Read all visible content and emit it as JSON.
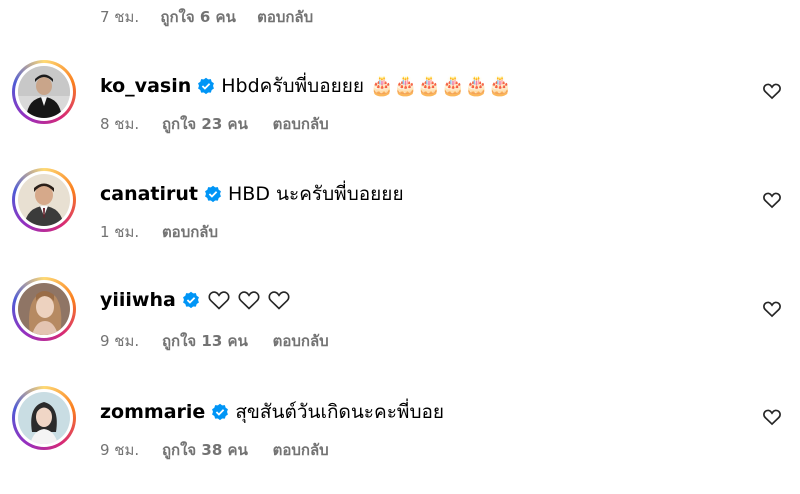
{
  "top_meta": {
    "time": "7 ชม.",
    "likes": "ถูกใจ 6 คน",
    "reply": "ตอบกลับ"
  },
  "comments": [
    {
      "username": "ko_vasin",
      "text": "Hbdครับพี่บอยยย 🎂🎂🎂🎂🎂🎂",
      "time": "8 ชม.",
      "likes": "ถูกใจ 23 คน",
      "reply": "ตอบกลับ"
    },
    {
      "username": "canatirut",
      "text": "HBD นะครับพี่บอยยย",
      "time": "1 ชม.",
      "likes": "",
      "reply": "ตอบกลับ"
    },
    {
      "username": "yiiiwha",
      "text": "",
      "time": "9 ชม.",
      "likes": "ถูกใจ 13 คน",
      "reply": "ตอบกลับ"
    },
    {
      "username": "zommarie",
      "text": "สุขสันต์วันเกิดนะคะพี่บอย",
      "time": "9 ชม.",
      "likes": "ถูกใจ 38 คน",
      "reply": "ตอบกลับ"
    }
  ],
  "colors": {
    "verified": "#0095f6",
    "muted": "#737373"
  }
}
